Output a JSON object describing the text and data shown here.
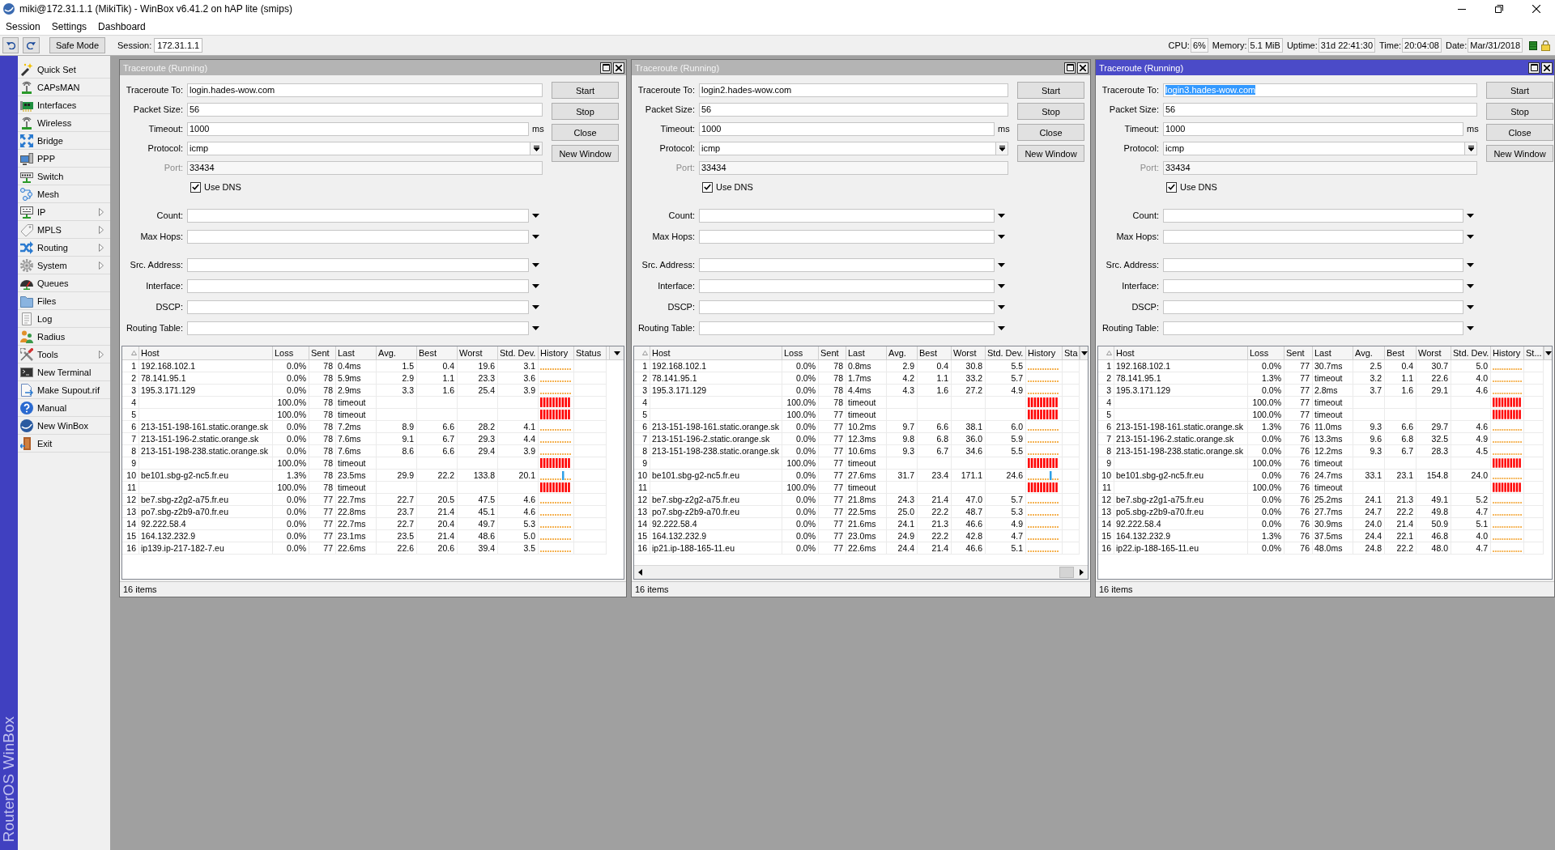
{
  "window": {
    "title": "miki@172.31.1.1 (MikiTik) - WinBox v6.41.2 on hAP lite (smips)"
  },
  "menu": [
    "Session",
    "Settings",
    "Dashboard"
  ],
  "toolbar": {
    "safe_mode": "Safe Mode",
    "session_label": "Session:",
    "session": "172.31.1.1",
    "stats": [
      {
        "label": "CPU:",
        "value": "6%"
      },
      {
        "label": "Memory:",
        "value": "5.1 MiB"
      },
      {
        "label": "Uptime:",
        "value": "31d 22:41:30"
      },
      {
        "label": "Time:",
        "value": "20:04:08"
      },
      {
        "label": "Date:",
        "value": "Mar/31/2018"
      }
    ]
  },
  "sidebar": {
    "items": [
      {
        "label": "Quick Set",
        "submenu": false
      },
      {
        "label": "CAPsMAN",
        "submenu": false
      },
      {
        "label": "Interfaces",
        "submenu": false
      },
      {
        "label": "Wireless",
        "submenu": false
      },
      {
        "label": "Bridge",
        "submenu": false
      },
      {
        "label": "PPP",
        "submenu": false
      },
      {
        "label": "Switch",
        "submenu": false
      },
      {
        "label": "Mesh",
        "submenu": false
      },
      {
        "label": "IP",
        "submenu": true
      },
      {
        "label": "MPLS",
        "submenu": true
      },
      {
        "label": "Routing",
        "submenu": true
      },
      {
        "label": "System",
        "submenu": true
      },
      {
        "label": "Queues",
        "submenu": false
      },
      {
        "label": "Files",
        "submenu": false
      },
      {
        "label": "Log",
        "submenu": false
      },
      {
        "label": "Radius",
        "submenu": false
      },
      {
        "label": "Tools",
        "submenu": true
      },
      {
        "label": "New Terminal",
        "submenu": false
      },
      {
        "label": "Make Supout.rif",
        "submenu": false
      },
      {
        "label": "Manual",
        "submenu": false
      },
      {
        "label": "New WinBox",
        "submenu": false
      },
      {
        "label": "Exit",
        "submenu": false
      }
    ],
    "brand": "RouterOS WinBox"
  },
  "traceroute_windows": [
    {
      "title": "Traceroute (Running)",
      "active": false,
      "form": {
        "groups": [
          [
            {
              "kind": "text",
              "label": "Traceroute To:",
              "value": "login.hades-wow.com",
              "highlighted": false,
              "disabled": false
            },
            {
              "kind": "text",
              "label": "Packet Size:",
              "value": "56",
              "disabled": false
            },
            {
              "kind": "unit",
              "label": "Timeout:",
              "value": "1000",
              "unit": "ms",
              "disabled": false
            },
            {
              "kind": "combo",
              "label": "Protocol:",
              "value": "icmp",
              "disabled": false
            },
            {
              "kind": "text",
              "label": "Port:",
              "value": "33434",
              "disabled": true
            },
            {
              "kind": "checkbox",
              "label": "Use DNS",
              "checked": true,
              "disabled": false
            }
          ],
          [
            {
              "kind": "optional",
              "label": "Count:",
              "disabled": false
            },
            {
              "kind": "optional",
              "label": "Max Hops:",
              "disabled": false
            }
          ],
          [
            {
              "kind": "optional",
              "label": "Src. Address:",
              "disabled": false
            },
            {
              "kind": "optional",
              "label": "Interface:",
              "disabled": false
            },
            {
              "kind": "optional",
              "label": "DSCP:",
              "disabled": false
            },
            {
              "kind": "optional",
              "label": "Routing Table:",
              "disabled": false
            }
          ]
        ]
      },
      "buttons": [
        "Start",
        "Stop",
        "Close",
        "New Window"
      ],
      "table": {
        "columns": [
          "Host",
          "Loss",
          "Sent",
          "Last",
          "Avg.",
          "Best",
          "Worst",
          "Std. Dev.",
          "History",
          "Status"
        ],
        "h_scrollbar": false,
        "rows": [
          {
            "no": "1",
            "host": "192.168.102.1",
            "loss": "0.0%",
            "sent": "78",
            "last": "0.4ms",
            "avg": "1.5",
            "best": "0.4",
            "worst": "19.6",
            "std_dev": "3.1",
            "kind": "ok"
          },
          {
            "no": "2",
            "host": "78.141.95.1",
            "loss": "0.0%",
            "sent": "78",
            "last": "5.9ms",
            "avg": "2.9",
            "best": "1.1",
            "worst": "23.3",
            "std_dev": "3.6",
            "kind": "ok"
          },
          {
            "no": "3",
            "host": "195.3.171.129",
            "loss": "0.0%",
            "sent": "78",
            "last": "2.9ms",
            "avg": "3.3",
            "best": "1.6",
            "worst": "25.4",
            "std_dev": "3.9",
            "kind": "ok"
          },
          {
            "no": "4",
            "loss": "100.0%",
            "sent": "78",
            "last": "timeout",
            "kind": "lost"
          },
          {
            "no": "5",
            "loss": "100.0%",
            "sent": "78",
            "last": "timeout",
            "kind": "lost"
          },
          {
            "no": "6",
            "host": "213-151-198-161.static.orange.sk",
            "loss": "0.0%",
            "sent": "78",
            "last": "7.2ms",
            "avg": "8.9",
            "best": "6.6",
            "worst": "28.2",
            "std_dev": "4.1",
            "kind": "ok"
          },
          {
            "no": "7",
            "host": "213-151-196-2.static.orange.sk",
            "loss": "0.0%",
            "sent": "78",
            "last": "7.6ms",
            "avg": "9.1",
            "best": "6.7",
            "worst": "29.3",
            "std_dev": "4.4",
            "kind": "ok"
          },
          {
            "no": "8",
            "host": "213-151-198-238.static.orange.sk",
            "loss": "0.0%",
            "sent": "78",
            "last": "7.6ms",
            "avg": "8.6",
            "best": "6.6",
            "worst": "29.4",
            "std_dev": "3.9",
            "kind": "ok"
          },
          {
            "no": "9",
            "loss": "100.0%",
            "sent": "78",
            "last": "timeout",
            "kind": "lost"
          },
          {
            "no": "10",
            "host": "be101.sbg-g2-nc5.fr.eu",
            "loss": "1.3%",
            "sent": "78",
            "last": "23.5ms",
            "avg": "29.9",
            "best": "22.2",
            "worst": "133.8",
            "std_dev": "20.1",
            "kind": "spike"
          },
          {
            "no": "11",
            "loss": "100.0%",
            "sent": "78",
            "last": "timeout",
            "kind": "lost"
          },
          {
            "no": "12",
            "host": "be7.sbg-z2g2-a75.fr.eu",
            "loss": "0.0%",
            "sent": "77",
            "last": "22.7ms",
            "avg": "22.7",
            "best": "20.5",
            "worst": "47.5",
            "std_dev": "4.6",
            "kind": "ok"
          },
          {
            "no": "13",
            "host": "po7.sbg-z2b9-a70.fr.eu",
            "loss": "0.0%",
            "sent": "77",
            "last": "22.8ms",
            "avg": "23.7",
            "best": "21.4",
            "worst": "45.1",
            "std_dev": "4.6",
            "kind": "ok"
          },
          {
            "no": "14",
            "host": "92.222.58.4",
            "loss": "0.0%",
            "sent": "77",
            "last": "22.7ms",
            "avg": "22.7",
            "best": "20.4",
            "worst": "49.7",
            "std_dev": "5.3",
            "kind": "ok"
          },
          {
            "no": "15",
            "host": "164.132.232.9",
            "loss": "0.0%",
            "sent": "77",
            "last": "23.1ms",
            "avg": "23.5",
            "best": "21.4",
            "worst": "48.6",
            "std_dev": "5.0",
            "kind": "ok"
          },
          {
            "no": "16",
            "host": "ip139.ip-217-182-7.eu",
            "loss": "0.0%",
            "sent": "77",
            "last": "22.6ms",
            "avg": "22.6",
            "best": "20.6",
            "worst": "39.4",
            "std_dev": "3.5",
            "kind": "ok"
          }
        ]
      },
      "status": "16 items"
    },
    {
      "title": "Traceroute (Running)",
      "active": false,
      "form": {
        "groups": [
          [
            {
              "kind": "text",
              "label": "Traceroute To:",
              "value": "login2.hades-wow.com",
              "highlighted": false,
              "disabled": false
            },
            {
              "kind": "text",
              "label": "Packet Size:",
              "value": "56",
              "disabled": false
            },
            {
              "kind": "unit",
              "label": "Timeout:",
              "value": "1000",
              "unit": "ms",
              "disabled": false
            },
            {
              "kind": "combo",
              "label": "Protocol:",
              "value": "icmp",
              "disabled": false
            },
            {
              "kind": "text",
              "label": "Port:",
              "value": "33434",
              "disabled": true
            },
            {
              "kind": "checkbox",
              "label": "Use DNS",
              "checked": true,
              "disabled": false
            }
          ],
          [
            {
              "kind": "optional",
              "label": "Count:",
              "disabled": false
            },
            {
              "kind": "optional",
              "label": "Max Hops:",
              "disabled": false
            }
          ],
          [
            {
              "kind": "optional",
              "label": "Src. Address:",
              "disabled": false
            },
            {
              "kind": "optional",
              "label": "Interface:",
              "disabled": false
            },
            {
              "kind": "optional",
              "label": "DSCP:",
              "disabled": false
            },
            {
              "kind": "optional",
              "label": "Routing Table:",
              "disabled": false
            }
          ]
        ]
      },
      "buttons": [
        "Start",
        "Stop",
        "Close",
        "New Window"
      ],
      "table": {
        "columns": [
          "Host",
          "Loss",
          "Sent",
          "Last",
          "Avg.",
          "Best",
          "Worst",
          "Std. Dev.",
          "History",
          "Sta"
        ],
        "h_scrollbar": true,
        "rows": [
          {
            "no": "1",
            "host": "192.168.102.1",
            "loss": "0.0%",
            "sent": "78",
            "last": "0.8ms",
            "avg": "2.9",
            "best": "0.4",
            "worst": "30.8",
            "std_dev": "5.5",
            "kind": "ok"
          },
          {
            "no": "2",
            "host": "78.141.95.1",
            "loss": "0.0%",
            "sent": "78",
            "last": "1.7ms",
            "avg": "4.2",
            "best": "1.1",
            "worst": "33.2",
            "std_dev": "5.7",
            "kind": "ok"
          },
          {
            "no": "3",
            "host": "195.3.171.129",
            "loss": "0.0%",
            "sent": "78",
            "last": "4.4ms",
            "avg": "4.3",
            "best": "1.6",
            "worst": "27.2",
            "std_dev": "4.9",
            "kind": "ok"
          },
          {
            "no": "4",
            "loss": "100.0%",
            "sent": "78",
            "last": "timeout",
            "kind": "lost"
          },
          {
            "no": "5",
            "loss": "100.0%",
            "sent": "77",
            "last": "timeout",
            "kind": "lost"
          },
          {
            "no": "6",
            "host": "213-151-198-161.static.orange.sk",
            "loss": "0.0%",
            "sent": "77",
            "last": "10.2ms",
            "avg": "9.7",
            "best": "6.6",
            "worst": "38.1",
            "std_dev": "6.0",
            "kind": "ok"
          },
          {
            "no": "7",
            "host": "213-151-196-2.static.orange.sk",
            "loss": "0.0%",
            "sent": "77",
            "last": "12.3ms",
            "avg": "9.8",
            "best": "6.8",
            "worst": "36.0",
            "std_dev": "5.9",
            "kind": "ok"
          },
          {
            "no": "8",
            "host": "213-151-198-238.static.orange.sk",
            "loss": "0.0%",
            "sent": "77",
            "last": "10.6ms",
            "avg": "9.3",
            "best": "6.7",
            "worst": "34.6",
            "std_dev": "5.5",
            "kind": "ok"
          },
          {
            "no": "9",
            "loss": "100.0%",
            "sent": "77",
            "last": "timeout",
            "kind": "lost"
          },
          {
            "no": "10",
            "host": "be101.sbg-g2-nc5.fr.eu",
            "loss": "0.0%",
            "sent": "77",
            "last": "27.6ms",
            "avg": "31.7",
            "best": "23.4",
            "worst": "171.1",
            "std_dev": "24.6",
            "kind": "spike"
          },
          {
            "no": "11",
            "loss": "100.0%",
            "sent": "77",
            "last": "timeout",
            "kind": "lost"
          },
          {
            "no": "12",
            "host": "be7.sbg-z2g2-a75.fr.eu",
            "loss": "0.0%",
            "sent": "77",
            "last": "21.8ms",
            "avg": "24.3",
            "best": "21.4",
            "worst": "47.0",
            "std_dev": "5.7",
            "kind": "ok"
          },
          {
            "no": "13",
            "host": "po7.sbg-z2b9-a70.fr.eu",
            "loss": "0.0%",
            "sent": "77",
            "last": "22.5ms",
            "avg": "25.0",
            "best": "22.2",
            "worst": "48.7",
            "std_dev": "5.3",
            "kind": "ok"
          },
          {
            "no": "14",
            "host": "92.222.58.4",
            "loss": "0.0%",
            "sent": "77",
            "last": "21.6ms",
            "avg": "24.1",
            "best": "21.3",
            "worst": "46.6",
            "std_dev": "4.9",
            "kind": "ok"
          },
          {
            "no": "15",
            "host": "164.132.232.9",
            "loss": "0.0%",
            "sent": "77",
            "last": "23.0ms",
            "avg": "24.9",
            "best": "22.2",
            "worst": "42.8",
            "std_dev": "4.7",
            "kind": "ok"
          },
          {
            "no": "16",
            "host": "ip21.ip-188-165-11.eu",
            "loss": "0.0%",
            "sent": "77",
            "last": "22.6ms",
            "avg": "24.4",
            "best": "21.4",
            "worst": "46.6",
            "std_dev": "5.1",
            "kind": "ok"
          }
        ]
      },
      "status": "16 items"
    },
    {
      "title": "Traceroute (Running)",
      "active": true,
      "form": {
        "groups": [
          [
            {
              "kind": "text",
              "label": "Traceroute To:",
              "value": "login3.hades-wow.com",
              "highlighted": true,
              "disabled": false
            },
            {
              "kind": "text",
              "label": "Packet Size:",
              "value": "56",
              "disabled": false
            },
            {
              "kind": "unit",
              "label": "Timeout:",
              "value": "1000",
              "unit": "ms",
              "disabled": false
            },
            {
              "kind": "combo",
              "label": "Protocol:",
              "value": "icmp",
              "disabled": false
            },
            {
              "kind": "text",
              "label": "Port:",
              "value": "33434",
              "disabled": true
            },
            {
              "kind": "checkbox",
              "label": "Use DNS",
              "checked": true,
              "disabled": false
            }
          ],
          [
            {
              "kind": "optional",
              "label": "Count:",
              "disabled": false
            },
            {
              "kind": "optional",
              "label": "Max Hops:",
              "disabled": false
            }
          ],
          [
            {
              "kind": "optional",
              "label": "Src. Address:",
              "disabled": false
            },
            {
              "kind": "optional",
              "label": "Interface:",
              "disabled": false
            },
            {
              "kind": "optional",
              "label": "DSCP:",
              "disabled": false
            },
            {
              "kind": "optional",
              "label": "Routing Table:",
              "disabled": false
            }
          ]
        ]
      },
      "buttons": [
        "Start",
        "Stop",
        "Close",
        "New Window"
      ],
      "table": {
        "columns": [
          "Host",
          "Loss",
          "Sent",
          "Last",
          "Avg.",
          "Best",
          "Worst",
          "Std. Dev.",
          "History",
          "St..."
        ],
        "h_scrollbar": false,
        "rows": [
          {
            "no": "1",
            "host": "192.168.102.1",
            "loss": "0.0%",
            "sent": "77",
            "last": "30.7ms",
            "avg": "2.5",
            "best": "0.4",
            "worst": "30.7",
            "std_dev": "5.0",
            "kind": "ok"
          },
          {
            "no": "2",
            "host": "78.141.95.1",
            "loss": "1.3%",
            "sent": "77",
            "last": "timeout",
            "avg": "3.2",
            "best": "1.1",
            "worst": "22.6",
            "std_dev": "4.0",
            "kind": "ok"
          },
          {
            "no": "3",
            "host": "195.3.171.129",
            "loss": "0.0%",
            "sent": "77",
            "last": "2.8ms",
            "avg": "3.7",
            "best": "1.6",
            "worst": "29.1",
            "std_dev": "4.6",
            "kind": "ok"
          },
          {
            "no": "4",
            "loss": "100.0%",
            "sent": "77",
            "last": "timeout",
            "kind": "lost"
          },
          {
            "no": "5",
            "loss": "100.0%",
            "sent": "77",
            "last": "timeout",
            "kind": "lost"
          },
          {
            "no": "6",
            "host": "213-151-198-161.static.orange.sk",
            "loss": "1.3%",
            "sent": "76",
            "last": "11.0ms",
            "avg": "9.3",
            "best": "6.6",
            "worst": "29.7",
            "std_dev": "4.6",
            "kind": "ok"
          },
          {
            "no": "7",
            "host": "213-151-196-2.static.orange.sk",
            "loss": "0.0%",
            "sent": "76",
            "last": "13.3ms",
            "avg": "9.6",
            "best": "6.8",
            "worst": "32.5",
            "std_dev": "4.9",
            "kind": "ok"
          },
          {
            "no": "8",
            "host": "213-151-198-238.static.orange.sk",
            "loss": "0.0%",
            "sent": "76",
            "last": "12.2ms",
            "avg": "9.3",
            "best": "6.7",
            "worst": "28.3",
            "std_dev": "4.5",
            "kind": "ok"
          },
          {
            "no": "9",
            "loss": "100.0%",
            "sent": "76",
            "last": "timeout",
            "kind": "lost"
          },
          {
            "no": "10",
            "host": "be101.sbg-g2-nc5.fr.eu",
            "loss": "0.0%",
            "sent": "76",
            "last": "24.7ms",
            "avg": "33.1",
            "best": "23.1",
            "worst": "154.8",
            "std_dev": "24.0",
            "kind": "ok"
          },
          {
            "no": "11",
            "loss": "100.0%",
            "sent": "76",
            "last": "timeout",
            "kind": "lost"
          },
          {
            "no": "12",
            "host": "be7.sbg-z2g1-a75.fr.eu",
            "loss": "0.0%",
            "sent": "76",
            "last": "25.2ms",
            "avg": "24.1",
            "best": "21.3",
            "worst": "49.1",
            "std_dev": "5.2",
            "kind": "ok"
          },
          {
            "no": "13",
            "host": "po5.sbg-z2b9-a70.fr.eu",
            "loss": "0.0%",
            "sent": "76",
            "last": "27.7ms",
            "avg": "24.7",
            "best": "22.2",
            "worst": "49.8",
            "std_dev": "4.7",
            "kind": "ok"
          },
          {
            "no": "14",
            "host": "92.222.58.4",
            "loss": "0.0%",
            "sent": "76",
            "last": "30.9ms",
            "avg": "24.0",
            "best": "21.4",
            "worst": "50.9",
            "std_dev": "5.1",
            "kind": "ok"
          },
          {
            "no": "15",
            "host": "164.132.232.9",
            "loss": "1.3%",
            "sent": "76",
            "last": "37.5ms",
            "avg": "24.4",
            "best": "22.1",
            "worst": "46.8",
            "std_dev": "4.0",
            "kind": "ok"
          },
          {
            "no": "16",
            "host": "ip22.ip-188-165-11.eu",
            "loss": "0.0%",
            "sent": "76",
            "last": "48.0ms",
            "avg": "24.8",
            "best": "22.2",
            "worst": "48.0",
            "std_dev": "4.7",
            "kind": "ok"
          }
        ]
      },
      "status": "16 items"
    }
  ]
}
